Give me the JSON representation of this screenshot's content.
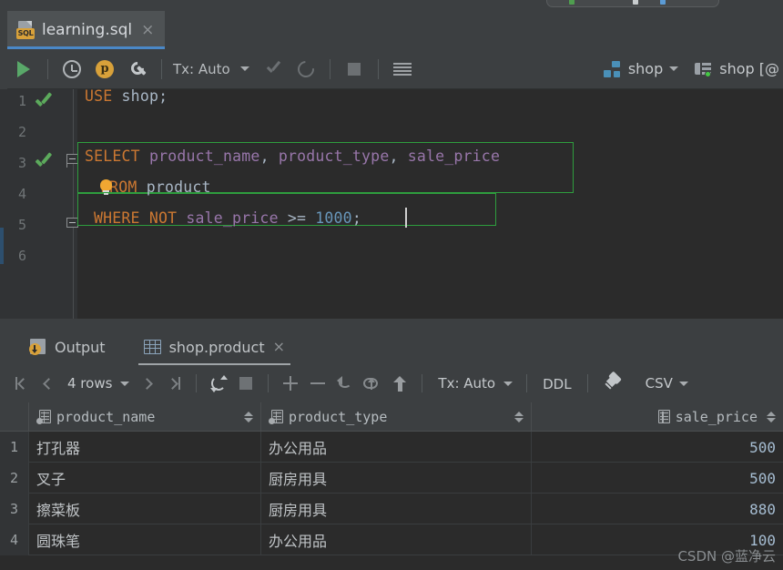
{
  "editor_tab": {
    "filename": "learning.sql",
    "icon": "sql-file-icon",
    "tag": "SQL",
    "close": "×"
  },
  "editor_toolbar": {
    "run_icon": "run-icon",
    "history_icon": "history-clock-icon",
    "profile_icon": "p-badge-icon",
    "settings_icon": "wrench-icon",
    "tx_label": "Tx: Auto",
    "commit_icon": "commit-check-icon",
    "rollback_icon": "rollback-icon",
    "stop_icon": "stop-icon",
    "grid_icon": "data-grid-icon",
    "schema_label": "shop",
    "connection_label": "shop [@"
  },
  "code": {
    "lines": [
      {
        "num": "1",
        "status": "ok"
      },
      {
        "num": "2",
        "status": ""
      },
      {
        "num": "3",
        "status": "ok"
      },
      {
        "num": "4",
        "status": ""
      },
      {
        "num": "5",
        "status": ""
      },
      {
        "num": "6",
        "status": ""
      }
    ],
    "l1_kw": "USE",
    "l1_rest": "shop;",
    "l3_kw": "SELECT",
    "l3_a": "product_name",
    "l3_c1": ",",
    "l3_b": "product_type",
    "l3_c2": ",",
    "l3_c": "sale_price",
    "l4_kw": "FROM",
    "l4_tbl": "product",
    "l5_kw1": "WHERE",
    "l5_kw2": "NOT",
    "l5_col": "sale_price",
    "l5_op": ">=",
    "l5_num": "1000",
    "l5_semi": ";"
  },
  "results": {
    "tabs": [
      {
        "label": "Output",
        "icon": "output-icon",
        "active": false
      },
      {
        "label": "shop.product",
        "icon": "table-icon",
        "active": true,
        "close": "×"
      }
    ],
    "toolbar": {
      "first_icon": "first-page-icon",
      "prev_icon": "prev-page-icon",
      "rows_label": "4 rows",
      "next_icon": "next-page-icon",
      "last_icon": "last-page-icon",
      "refresh_icon": "refresh-icon",
      "stop_icon": "stop-icon",
      "add_icon": "add-row-icon",
      "remove_icon": "remove-row-icon",
      "revert_icon": "revert-icon",
      "view_icon": "view-query-icon",
      "submit_icon": "submit-icon",
      "tx_label": "Tx: Auto",
      "ddl_label": "DDL",
      "pin_icon": "pin-icon",
      "csv_label": "CSV"
    },
    "columns": [
      {
        "name": "product_name",
        "type": "text"
      },
      {
        "name": "product_type",
        "type": "text"
      },
      {
        "name": "sale_price",
        "type": "number"
      }
    ],
    "rows": [
      {
        "n": "1",
        "product_name": "打孔器",
        "product_type": "办公用品",
        "sale_price": "500"
      },
      {
        "n": "2",
        "product_name": "叉子",
        "product_type": "厨房用具",
        "sale_price": "500"
      },
      {
        "n": "3",
        "product_name": "擦菜板",
        "product_type": "厨房用具",
        "sale_price": "880"
      },
      {
        "n": "4",
        "product_name": "圆珠笔",
        "product_type": "办公用品",
        "sale_price": "100"
      }
    ]
  },
  "watermark": "CSDN @蓝净云",
  "colors": {
    "accent_tab": "#4a88c7",
    "keyword": "#cc7832",
    "identifier": "#9876aa",
    "number": "#6897bb",
    "green_box": "#2e9e3e",
    "run_green": "#59a869",
    "editor_bg": "#2b2b2b",
    "panel_bg": "#3c3f41"
  }
}
